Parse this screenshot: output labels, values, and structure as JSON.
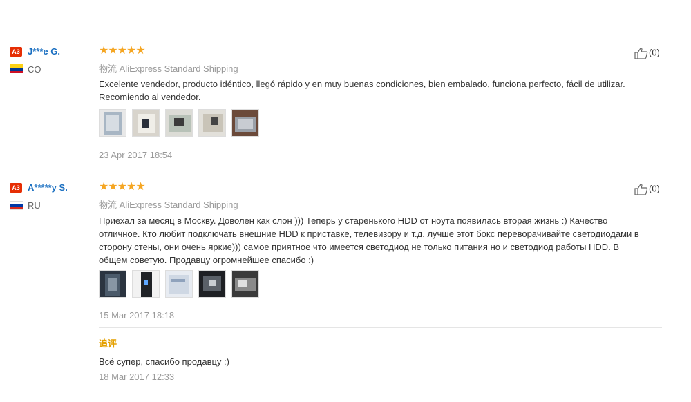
{
  "reviews": [
    {
      "badge": "A3",
      "name": "J***e G.",
      "country": "CO",
      "flag": [
        "#fcd116",
        "#003893",
        "#ce1126"
      ],
      "stars": "★★★★★",
      "shipping_label": "物流",
      "shipping": "AliExpress Standard Shipping",
      "text": "Excelente vendedor, producto idéntico, llegó rápido y en muy buenas condiciones, bien embalado, funciona perfecto, fácil de utilizar. Recomiendo al vendedor.",
      "date": "23 Apr 2017 18:54",
      "likes": "(0)"
    },
    {
      "badge": "A3",
      "name": "A*****y S.",
      "country": "RU",
      "flag": [
        "#ffffff",
        "#0039a6",
        "#d52b1e"
      ],
      "stars": "★★★★★",
      "shipping_label": "物流",
      "shipping": "AliExpress Standard Shipping",
      "text": "Приехал за месяц в Москву. Доволен как слон ))) Теперь у старенького HDD от ноута появилась вторая жизнь :) Качество отличное. Кто любит подключать внешние HDD к приставке, телевизору и т.д. лучше этот бокс переворачивайте светодиодами в сторону стены, они очень яркие))) самое приятное что имеется светодиод не только питания но и светодиод работы HDD. В общем советую. Продавцу огромнейшее спасибо :)",
      "date": "15 Mar 2017 18:18",
      "likes": "(0)",
      "followup": {
        "label": "追评",
        "text": "Всё супер, спасибо продавцу :)",
        "date": "18 Mar 2017 12:33"
      }
    }
  ]
}
